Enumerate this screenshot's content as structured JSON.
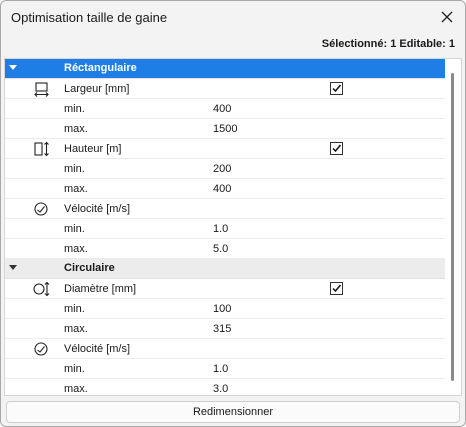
{
  "window": {
    "title": "Optimisation taille de gaine",
    "status": "Sélectionné: 1 Editable: 1"
  },
  "sections": [
    {
      "label": "Réctangulaire",
      "selected": true,
      "properties": [
        {
          "label": "Largeur [mm]",
          "icon": "width-icon",
          "checked": true,
          "min": "400",
          "max": "1500"
        },
        {
          "label": "Hauteur [m]",
          "icon": "height-icon",
          "checked": true,
          "min": "200",
          "max": "400"
        },
        {
          "label": "Vélocité [m/s]",
          "icon": "velocity-icon",
          "checked": null,
          "min": "1.0",
          "max": "5.0"
        }
      ]
    },
    {
      "label": "Circulaire",
      "selected": false,
      "properties": [
        {
          "label": "Diamètre [mm]",
          "icon": "diameter-icon",
          "checked": true,
          "min": "100",
          "max": "315"
        },
        {
          "label": "Vélocité [m/s]",
          "icon": "velocity-icon",
          "checked": null,
          "min": "1.0",
          "max": "3.0"
        }
      ]
    }
  ],
  "labels": {
    "min": "min.",
    "max": "max."
  },
  "actions": {
    "resize": "Redimensionner"
  },
  "colors": {
    "selection": "#1f7ee6",
    "section_bg": "#ececec"
  }
}
